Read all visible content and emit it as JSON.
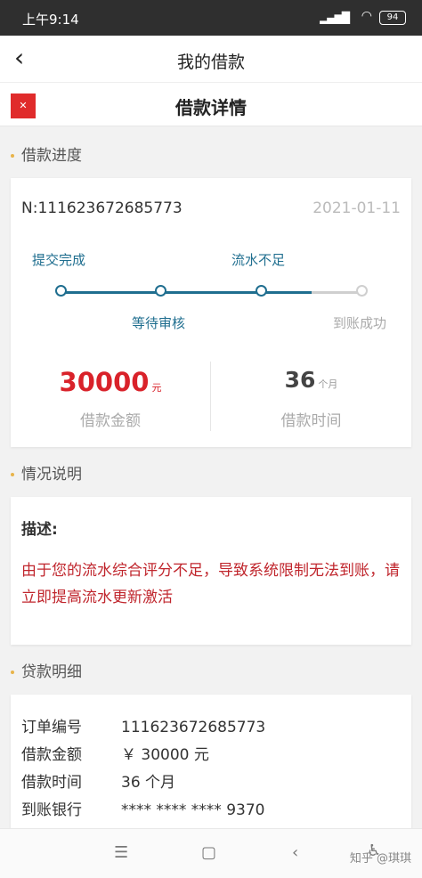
{
  "statusbar": {
    "time": "上午9:14",
    "battery": "94"
  },
  "navbar": {
    "back_icon": "‹",
    "title": "我的借款"
  },
  "subheader": {
    "title": "借款详情"
  },
  "progress_section": {
    "label": "借款进度",
    "order_no": "N:111623672685773",
    "date": "2021-01-11",
    "steps": [
      "提交完成",
      "等待审核",
      "流水不足",
      "到账成功"
    ],
    "amount": {
      "value": "30000",
      "unit": "元",
      "label": "借款金额"
    },
    "term": {
      "value": "36",
      "unit": "个月",
      "label": "借款时间"
    },
    "colors": {
      "active": "#1f6e8f",
      "inactive": "#cfcfcf",
      "amount": "#d9222a"
    }
  },
  "situation_section": {
    "label": "情况说明",
    "title": "描述:",
    "text": "由于您的流水综合评分不足，导致系统限制无法到账，请立即提高流水更新激活"
  },
  "detail_section": {
    "label": "贷款明细",
    "rows": [
      {
        "key": "订单编号",
        "value": "111623672685773"
      },
      {
        "key": "借款金额",
        "value": "￥ 30000 元"
      },
      {
        "key": "借款时间",
        "value": "36 个月"
      },
      {
        "key": "到账银行",
        "value": "**** **** ****  9370"
      }
    ]
  },
  "bottombar": {
    "watermark": "知乎 @琪琪"
  }
}
